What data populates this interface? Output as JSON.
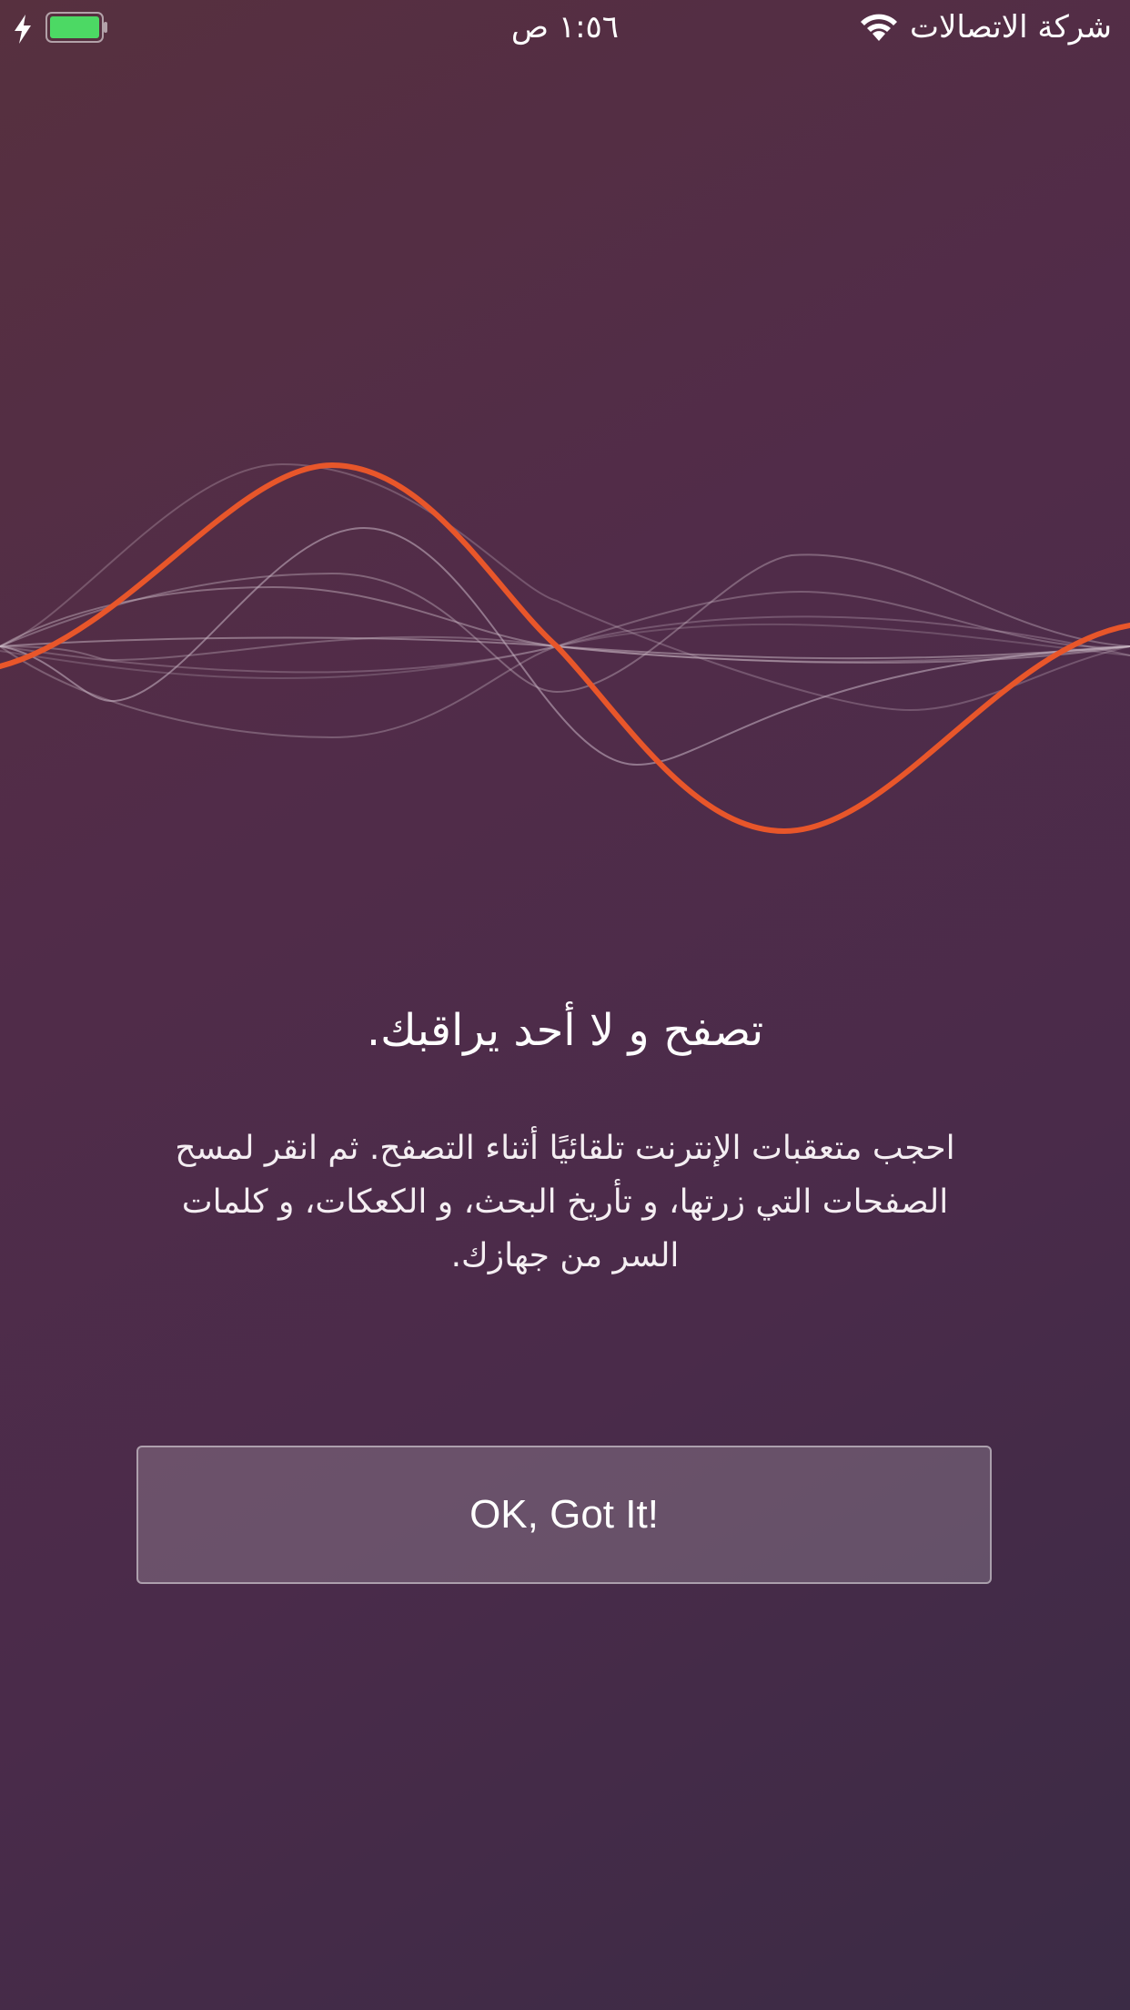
{
  "status_bar": {
    "time": "١:٥٦ ص",
    "carrier": "شركة الاتصالات",
    "icons": [
      "charging-bolt-icon",
      "battery-icon",
      "wifi-icon"
    ],
    "battery_color": "#4cd964"
  },
  "onboarding": {
    "title": "تصفح و لا أحد يراقبك.",
    "description": "احجب متعقبات الإنترنت تلقائيًا أثناء التصفح. ثم انقر لمسح الصفحات التي زرتها، و تأريخ البحث، و الكعكات، و كلمات السر من جهازك.",
    "button_label": "OK, Got It!"
  },
  "theme": {
    "accent": "#e8562a",
    "wave_lines": "#c9b7c4"
  }
}
